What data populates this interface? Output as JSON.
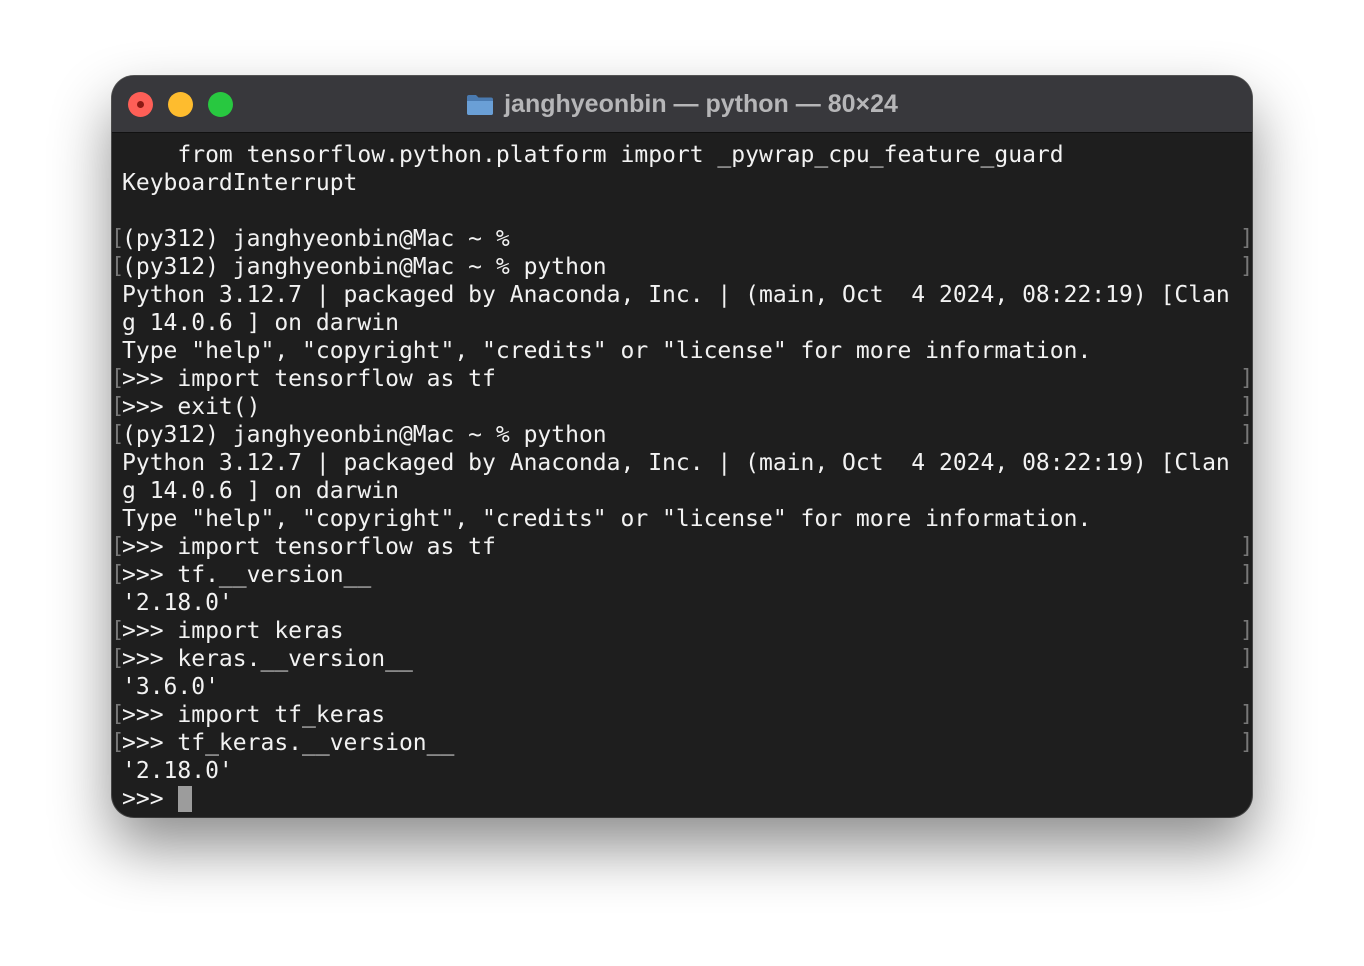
{
  "window": {
    "title": "janghyeonbin — python — 80×24"
  },
  "terminal": {
    "lines": [
      {
        "text": "    from tensorflow.python.platform import _pywrap_cpu_feature_guard",
        "marked": false
      },
      {
        "text": "KeyboardInterrupt",
        "marked": false
      },
      {
        "text": "",
        "marked": false
      },
      {
        "text": "(py312) janghyeonbin@Mac ~ %",
        "marked": true
      },
      {
        "text": "(py312) janghyeonbin@Mac ~ % python",
        "marked": true
      },
      {
        "text": "Python 3.12.7 | packaged by Anaconda, Inc. | (main, Oct  4 2024, 08:22:19) [Clan",
        "marked": false
      },
      {
        "text": "g 14.0.6 ] on darwin",
        "marked": false
      },
      {
        "text": "Type \"help\", \"copyright\", \"credits\" or \"license\" for more information.",
        "marked": false
      },
      {
        "text": ">>> import tensorflow as tf",
        "marked": true
      },
      {
        "text": ">>> exit()",
        "marked": true
      },
      {
        "text": "(py312) janghyeonbin@Mac ~ % python",
        "marked": true
      },
      {
        "text": "Python 3.12.7 | packaged by Anaconda, Inc. | (main, Oct  4 2024, 08:22:19) [Clan",
        "marked": false
      },
      {
        "text": "g 14.0.6 ] on darwin",
        "marked": false
      },
      {
        "text": "Type \"help\", \"copyright\", \"credits\" or \"license\" for more information.",
        "marked": false
      },
      {
        "text": ">>> import tensorflow as tf",
        "marked": true
      },
      {
        "text": ">>> tf.__version__",
        "marked": true
      },
      {
        "text": "'2.18.0'",
        "marked": false
      },
      {
        "text": ">>> import keras",
        "marked": true
      },
      {
        "text": ">>> keras.__version__",
        "marked": true
      },
      {
        "text": "'3.6.0'",
        "marked": false
      },
      {
        "text": ">>> import tf_keras",
        "marked": true
      },
      {
        "text": ">>> tf_keras.__version__",
        "marked": true
      },
      {
        "text": "'2.18.0'",
        "marked": false
      },
      {
        "text": ">>> ",
        "marked": false
      }
    ],
    "bracket_left": "[",
    "bracket_right": "]"
  },
  "icons": {
    "close": "close-icon",
    "minimize": "minimize-icon",
    "zoom": "zoom-icon",
    "folder": "folder-icon"
  },
  "colors": {
    "background": "#1e1e1e",
    "titlebar": "#38383c",
    "text": "#f2f2f2",
    "close": "#fe5f57",
    "minimize": "#febc2e",
    "zoom": "#28c840",
    "folder": "#5b8fc9"
  }
}
